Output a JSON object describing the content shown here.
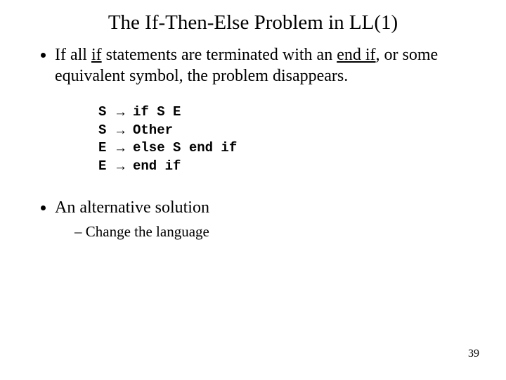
{
  "title": "The If-Then-Else Problem in LL(1)",
  "bullet1": {
    "pre": "If all ",
    "u1": "if",
    "mid": " statements are terminated with an ",
    "u2": "end if",
    "post": ", or some equivalent symbol, the problem disappears."
  },
  "grammar": [
    {
      "lhs": "S",
      "rhs": " if S E"
    },
    {
      "lhs": "S",
      "rhs": " Other"
    },
    {
      "lhs": "E",
      "rhs": " else S end if"
    },
    {
      "lhs": "E",
      "rhs": "end if"
    }
  ],
  "arrow": "→",
  "bullet2": "An alternative solution",
  "sub1": "Change the language",
  "pagenum": "39"
}
